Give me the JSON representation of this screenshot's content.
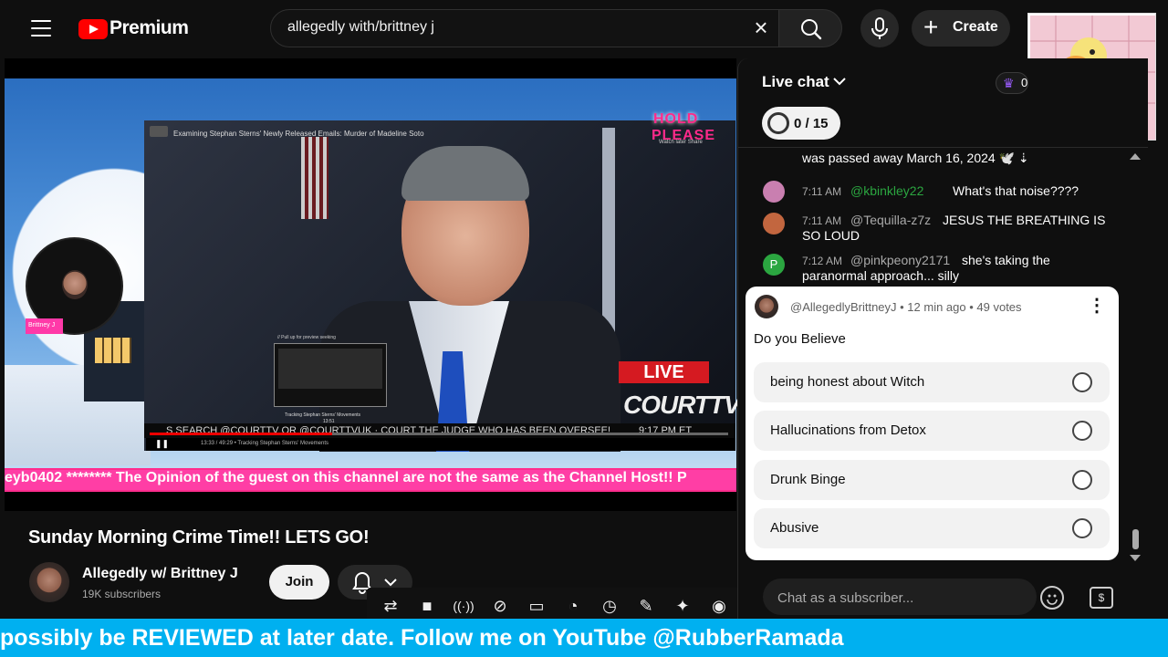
{
  "topbar": {
    "brand": "Premium",
    "search_value": "allegedly with/brittney j",
    "clear_glyph": "×",
    "create_label": "Create",
    "create_plus": "+"
  },
  "video_overlay": {
    "avatar_tag": "Brittney J",
    "inner_title": "Examining Stephan Sterns' Newly Released Emails: Murder of Madeline Soto",
    "hold_line1": "HOLD",
    "hold_line2": "PLEASE",
    "hold_sub": "Watch later     Share",
    "popup_head": "// Pull up for preview seeking",
    "popup_caption": "Tracking Stephan Sterns' Movements",
    "popup_time": "13:51",
    "live_label": "LIVE",
    "court_logo": "COURTTV",
    "ticker": "S SEARCH @COURTTV OR @COURTTVUK  ·  COURT  THE JUDGE WHO HAS BEEN OVERSEE!",
    "ticker_time": "9:17 PM ET",
    "controls": "13:33 / 49:29 • Tracking Stephan Sterns' Movements",
    "pink_banner": "eyb0402 ******** The Opinion of the guest on this channel are not the same as the Channel Host!! P"
  },
  "video": {
    "title": "Sunday Morning Crime Time!! LETS GO!",
    "channel_name": "Allegedly w/ Brittney J",
    "subscribers": "19K subscribers",
    "join_label": "Join"
  },
  "chat": {
    "header": "Live chat",
    "goal": "0 / 15",
    "badge_count": "0",
    "messages": [
      {
        "time": "",
        "user": "",
        "text": "was passed away March 16, 2024 🕊️ ⇣",
        "avatar_color": "#0f0f0f"
      },
      {
        "time": "7:11 AM",
        "user": "@kbinkley22",
        "text": "What's that noise????",
        "avatar_color": "#c97fb0",
        "user_color": "#2ba640"
      },
      {
        "time": "7:11 AM",
        "user": "@Tequilla-z7z",
        "text": "JESUS THE BREATHING IS SO LOUD",
        "avatar_color": "#c2663f"
      },
      {
        "time": "7:12 AM",
        "user": "@pinkpeony2171",
        "text": "she's taking the paranormal approach... silly",
        "avatar_color": "#2ba640",
        "avatar_letter": "P"
      }
    ],
    "poll": {
      "meta": "@AllegedlyBrittneyJ • 12 min ago • 49 votes",
      "question": "Do you Believe",
      "options": [
        "being honest about Witch",
        "Hallucinations from Detox",
        "Drunk Binge",
        "Abusive"
      ]
    },
    "input_placeholder": "Chat as a subscriber..."
  },
  "bottom_ticker": "possibly be REVIEWED at later date. Follow me on YouTube @RubberRamada"
}
